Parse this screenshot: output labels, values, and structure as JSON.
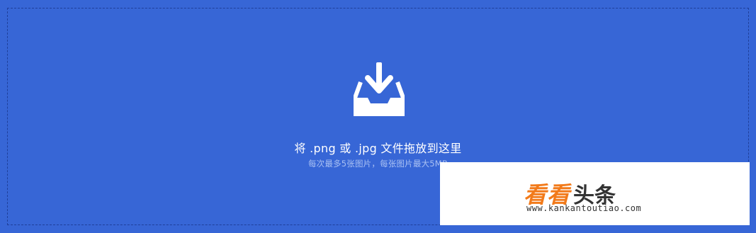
{
  "dropzone": {
    "icon": "tray-download-icon",
    "main_text": "将 .png 或 .jpg 文件拖放到这里",
    "sub_text": "每次最多5张图片，每张图片最大5MB"
  },
  "watermark": {
    "logo_part1": "看看",
    "logo_part2": "头条",
    "url": "www.kankantoutiao.com"
  },
  "colors": {
    "background": "#3766d6",
    "border": "#1f3f9a",
    "sub_text": "#a9c0f3",
    "logo_orange": "#f27a1a"
  }
}
